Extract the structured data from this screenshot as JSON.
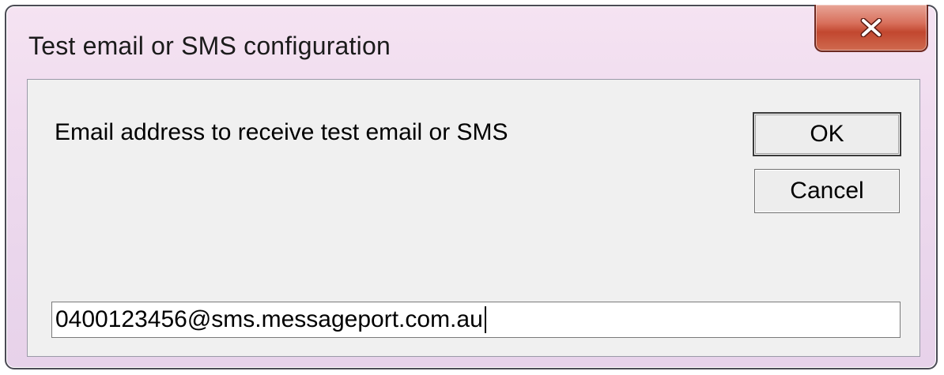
{
  "window": {
    "title": "Test email or SMS configuration",
    "close_icon": "close-x-icon"
  },
  "dialog": {
    "prompt": "Email address to receive test email or SMS",
    "ok_label": "OK",
    "cancel_label": "Cancel",
    "email_value": "0400123456@sms.messageport.com.au"
  },
  "colors": {
    "frame_border": "#4b4b55",
    "close_button": "#c2472f",
    "client_background": "#f0f0f0"
  }
}
